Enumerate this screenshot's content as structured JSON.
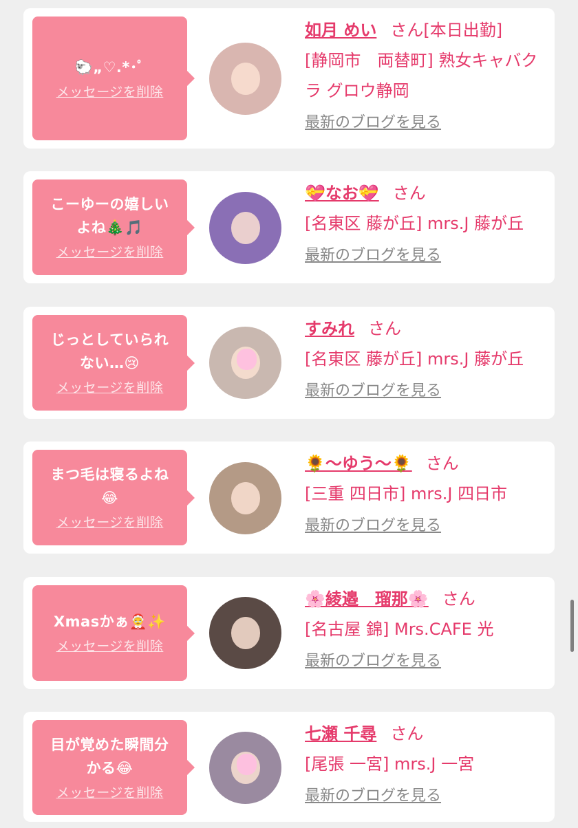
{
  "cards": [
    {
      "message": "🐑„♡.*･ﾟ",
      "delete_label": "メッセージを削除",
      "name": "如月 めい",
      "honorific": "さん",
      "status": "[本日出勤]",
      "location": "[静岡市　両替町] 熟女キャバクラ グロウ静岡",
      "blog_label": "最新のブログを見る",
      "avatar_bg": "#d9b6b0"
    },
    {
      "message": "こーゆーの嬉しい\nよね🎄🎵",
      "delete_label": "メッセージを削除",
      "name": "💝なお💝",
      "honorific": "さん",
      "status": "",
      "location": "[名東区 藤が丘] mrs.J 藤が丘",
      "blog_label": "最新のブログを見る",
      "avatar_bg": "#8a6fb5"
    },
    {
      "message": "じっとしていられ\nない…😢",
      "delete_label": "メッセージを削除",
      "name": "すみれ",
      "honorific": "さん",
      "status": "",
      "location": "[名東区 藤が丘] mrs.J 藤が丘",
      "blog_label": "最新のブログを見る",
      "avatar_bg": "#c9b8b0"
    },
    {
      "message": "まつ毛は寝るよね\n😂",
      "delete_label": "メッセージを削除",
      "name": "🌻〜ゆう〜🌻",
      "honorific": "さん",
      "status": "",
      "location": "[三重 四日市] mrs.J 四日市",
      "blog_label": "最新のブログを見る",
      "avatar_bg": "#b49a86"
    },
    {
      "message": "Xmasかぁ🤶✨",
      "delete_label": "メッセージを削除",
      "name": "🌸綾邉　瑠那🌸",
      "honorific": "さん",
      "status": "",
      "location": "[名古屋 錦] Mrs.CAFE 光",
      "blog_label": "最新のブログを見る",
      "avatar_bg": "#5a4a45"
    },
    {
      "message": "目が覚めた瞬間分\nかる😂",
      "delete_label": "メッセージを削除",
      "name": "七瀬 千尋",
      "honorific": "さん",
      "status": "",
      "location": "[尾張 一宮] mrs.J 一宮",
      "blog_label": "最新のブログを見る",
      "avatar_bg": "#9a8aa0"
    }
  ]
}
